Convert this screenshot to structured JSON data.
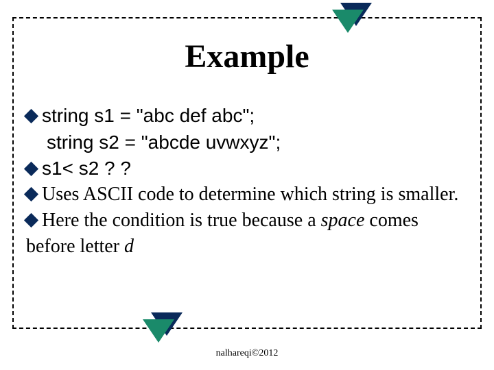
{
  "title": "Example",
  "bullets": {
    "b1_line1_pre": "string",
    "b1_line1_rest": " s1 = \"abc def abc\";",
    "b1_line2": "string s2 = \"abcde uvwxyz\";",
    "b2": "s1< s2   ? ?",
    "b3": "Uses ASCII code to determine which string is smaller.",
    "b4_pre": "Here the condition is true because a ",
    "b4_space": "space",
    "b4_mid": " comes before letter ",
    "b4_d": "d"
  },
  "footer": "nalhareqi©2012"
}
